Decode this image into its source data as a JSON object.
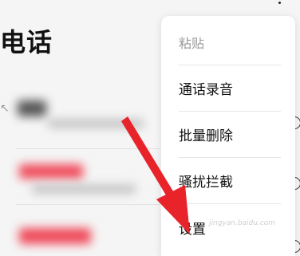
{
  "header": {
    "title": "电话",
    "more_icon": "more-dots-icon"
  },
  "menu": {
    "items": [
      {
        "label": "粘贴",
        "disabled": true
      },
      {
        "label": "通话录音",
        "disabled": false
      },
      {
        "label": "批量删除",
        "disabled": false
      },
      {
        "label": "骚扰拦截",
        "disabled": false
      },
      {
        "label": "设置",
        "disabled": false
      }
    ]
  },
  "watermark": {
    "text": "jingyan.baidu.com"
  },
  "annotation": {
    "arrow_color": "#e8232a",
    "points_to": "设置"
  },
  "colors": {
    "accent": "#e8232a",
    "menu_bg": "#ffffff",
    "page_bg": "#f5f5f5"
  }
}
